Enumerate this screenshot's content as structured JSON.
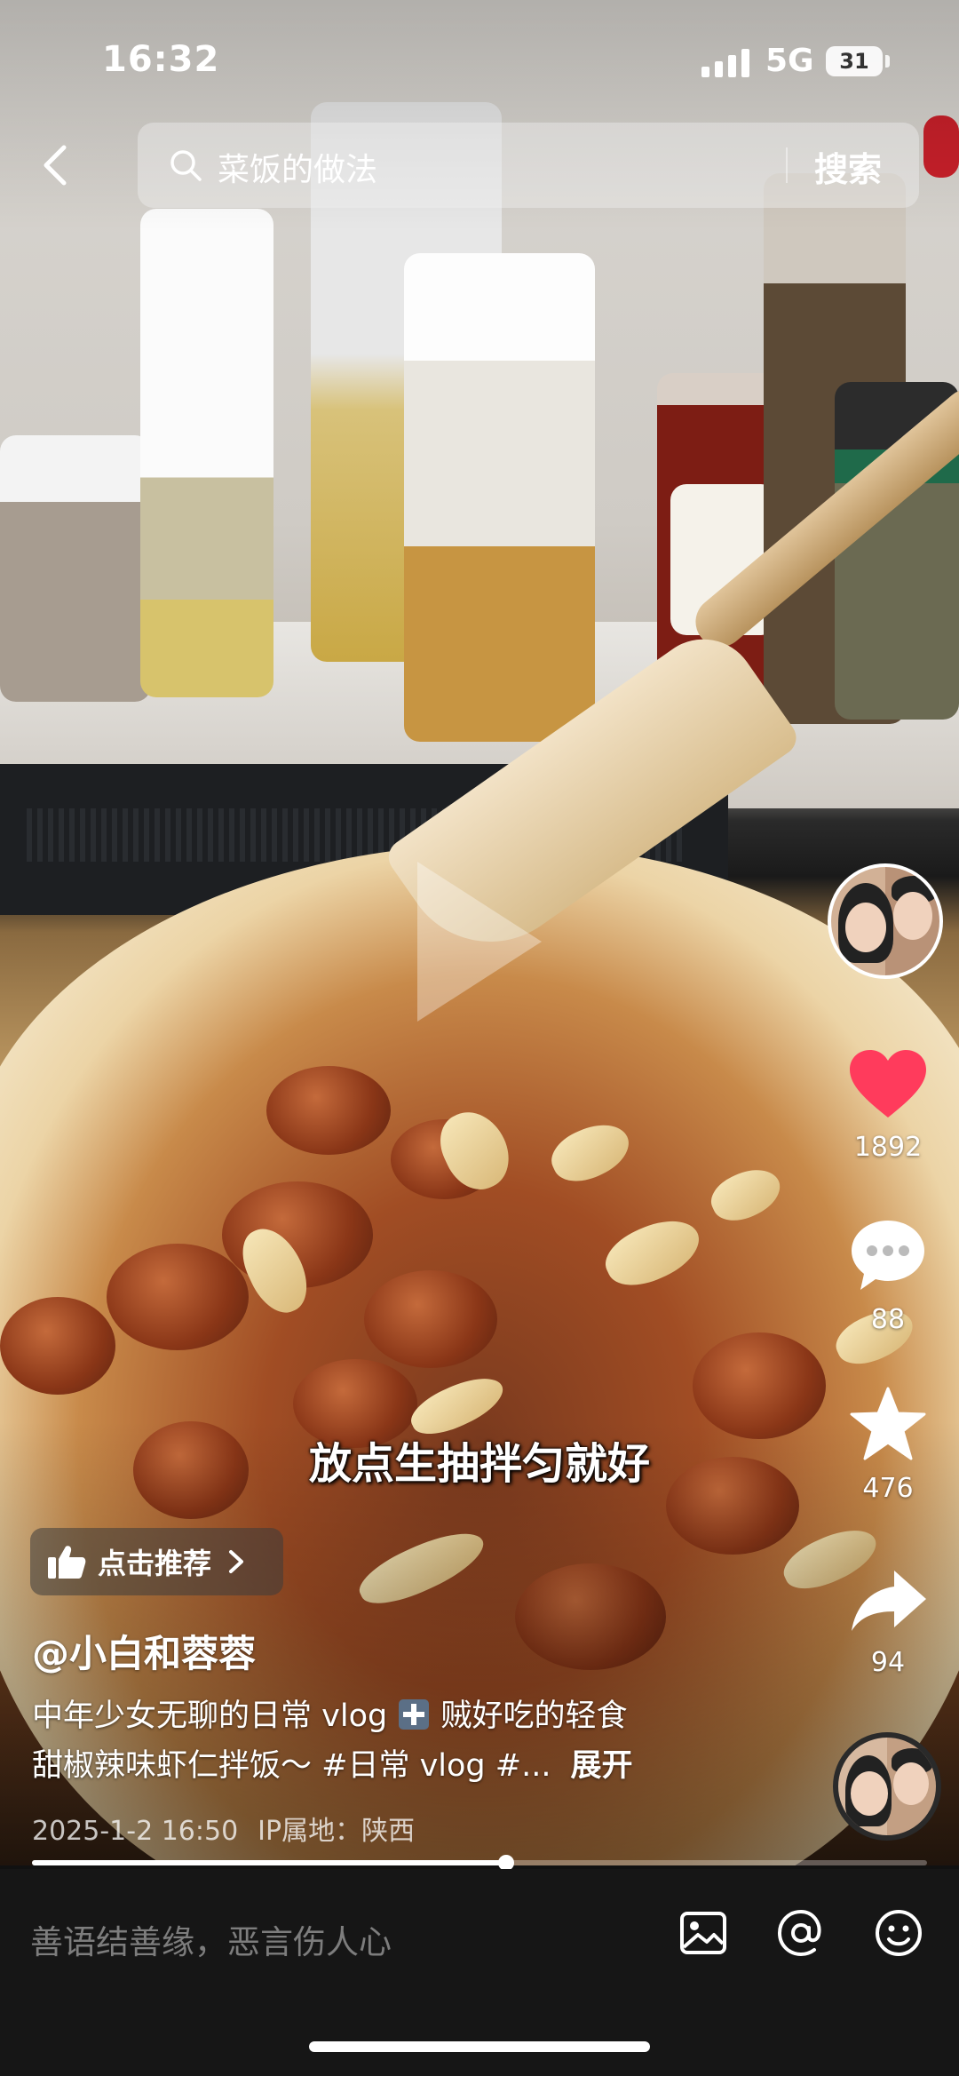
{
  "status_bar": {
    "time": "16:32",
    "network": "5G",
    "battery": "31"
  },
  "search": {
    "query": "菜饭的做法",
    "button": "搜索"
  },
  "actions": {
    "like_count": "1892",
    "comment_count": "88",
    "favorite_count": "476",
    "share_count": "94",
    "like_color": "#ff3b5c"
  },
  "video": {
    "subtitle": "放点生抽拌匀就好",
    "recommend_label": "点击推荐",
    "author": "@小白和蓉蓉",
    "description_line1_a": "中年少女无聊的日常 vlog",
    "description_line1_b": "贼好吃的轻食",
    "description_line2": "甜椒辣味虾仁拌饭～ #日常 vlog #...",
    "expand": "展开",
    "date": "2025-1-2 16:50",
    "location": "IP属地：陕西",
    "progress": 0.53
  },
  "comment_bar": {
    "placeholder": "善语结善缘，恶言伤人心"
  },
  "icons": [
    "back-icon",
    "search-icon",
    "thumbs-up-icon",
    "chevron-right-icon",
    "heart-icon",
    "comment-icon",
    "star-icon",
    "share-icon",
    "plus-icon",
    "image-icon",
    "at-icon",
    "emoji-icon"
  ]
}
